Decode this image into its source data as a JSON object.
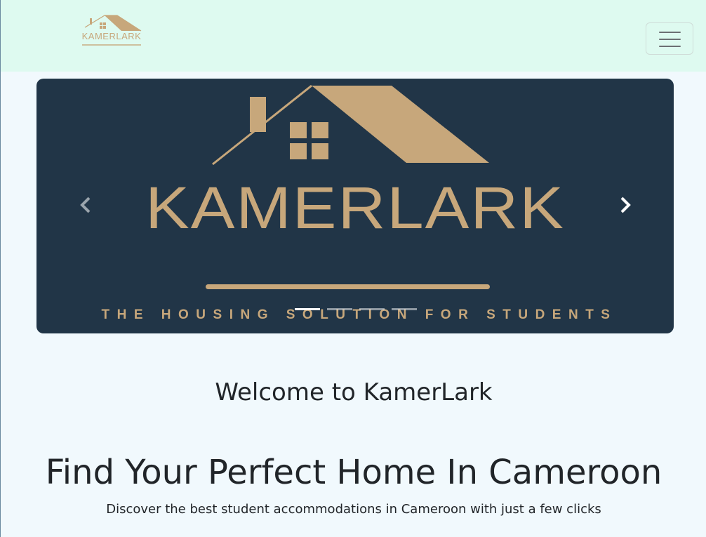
{
  "navbar": {
    "brand_text": "KAMERLARK",
    "toggle_icon": "hamburger-menu-icon",
    "colors": {
      "background": "#defaf0",
      "brand": "#c7a77b"
    }
  },
  "carousel": {
    "slide": {
      "title": "KAMERLARK",
      "tagline": "THE HOUSING SOLUTION FOR STUDENTS",
      "logo_icon": "house-roof-icon"
    },
    "prev_icon": "chevron-left-icon",
    "next_icon": "chevron-right-icon",
    "indicator_count": 4,
    "active_index": 0,
    "colors": {
      "background": "#213547",
      "accent": "#c7a77b"
    }
  },
  "main": {
    "welcome": "Welcome to KamerLark",
    "headline": "Find Your Perfect Home In Cameroon",
    "subtitle": "Discover the best student accommodations in Cameroon with just a few clicks"
  }
}
